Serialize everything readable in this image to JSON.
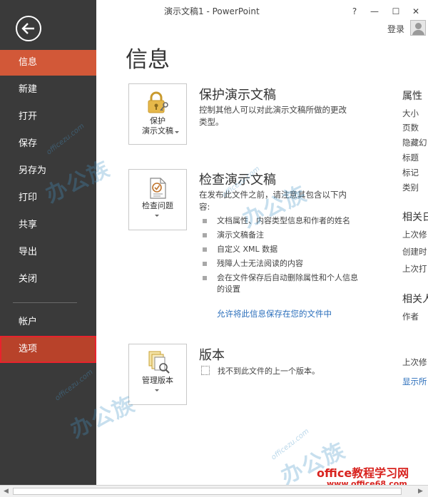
{
  "window": {
    "title": "演示文稿1 - PowerPoint",
    "help_label": "?",
    "minimize_label": "—",
    "restore_label": "☐",
    "close_label": "✕",
    "login_label": "登录"
  },
  "nav": {
    "items": [
      {
        "label": "信息"
      },
      {
        "label": "新建"
      },
      {
        "label": "打开"
      },
      {
        "label": "保存"
      },
      {
        "label": "另存为"
      },
      {
        "label": "打印"
      },
      {
        "label": "共享"
      },
      {
        "label": "导出"
      },
      {
        "label": "关闭"
      },
      {
        "label": "帐户"
      },
      {
        "label": "选项"
      }
    ]
  },
  "main": {
    "page_title": "信息",
    "protect": {
      "tile_line1": "保护",
      "tile_line2": "演示文稿",
      "title": "保护演示文稿",
      "desc": "控制其他人可以对此演示文稿所做的更改类型。"
    },
    "inspect": {
      "tile_label": "检查问题",
      "title": "检查演示文稿",
      "desc": "在发布此文件之前，请注意其包含以下内容:",
      "bullets": [
        "文档属性、内容类型信息和作者的姓名",
        "演示文稿备注",
        "自定义 XML 数据",
        "残障人士无法阅读的内容",
        "会在文件保存后自动删除属性和个人信息的设置"
      ],
      "link": "允许将此信息保存在您的文件中"
    },
    "versions": {
      "tile_label": "管理版本",
      "title": "版本",
      "desc": "找不到此文件的上一个版本。"
    }
  },
  "properties": {
    "header": "属性",
    "items": [
      "大小",
      "页数",
      "隐藏幻",
      "标题",
      "标记",
      "类别"
    ],
    "dates_header": "相关日",
    "dates": [
      "上次修",
      "创建时",
      "上次打"
    ],
    "people_header": "相关人",
    "people": [
      "作者"
    ],
    "last_modified": "上次修",
    "show_all": "显示所"
  },
  "watermark": {
    "small": "officezu.com",
    "big": "办公族",
    "brand": "office教程学习网",
    "url": "www.office68.com"
  }
}
